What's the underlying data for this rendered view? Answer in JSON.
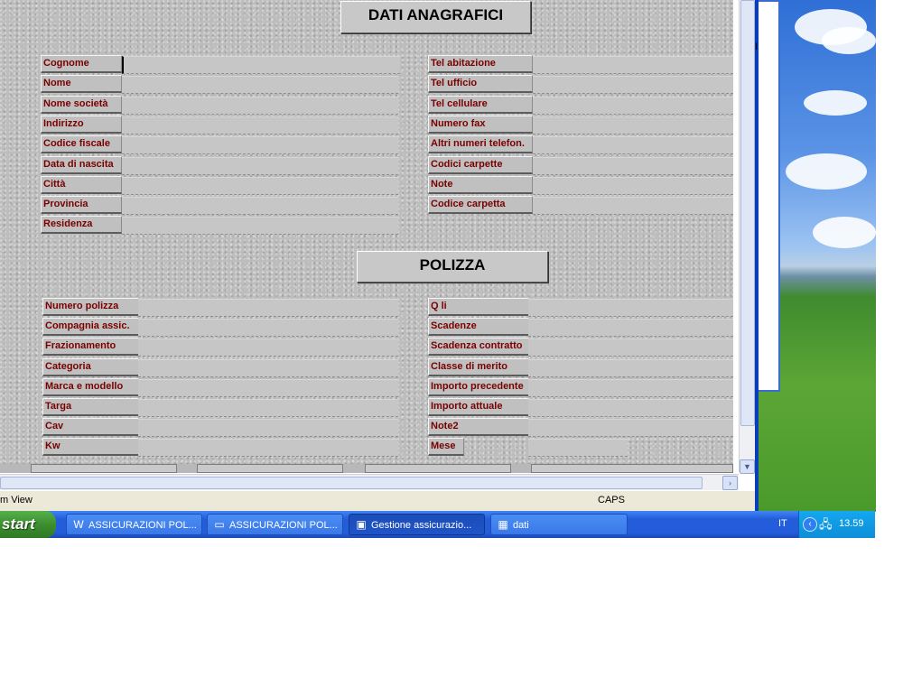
{
  "form": {
    "section1_title": "DATI ANAGRAFICI",
    "section2_title": "POLIZZA",
    "left1": [
      "Cognome",
      "Nome",
      "Nome società",
      "Indirizzo",
      "Codice fiscale",
      "Data di nascita",
      "Città",
      "Provincia",
      "Residenza"
    ],
    "right1": [
      "Tel  abitazione",
      "Tel ufficio",
      "Tel cellulare",
      "Numero fax",
      "Altri numeri telefon.",
      "Codici carpette",
      "Note",
      "Codice carpetta"
    ],
    "left2": [
      "Numero polizza",
      "Compagnia assic.",
      "Frazionamento",
      "Categoria",
      "Marca e modello",
      "Targa",
      "Cav",
      "Kw"
    ],
    "right2": [
      "Q li",
      "Scadenze",
      "Scadenza contratto",
      "Classe di merito",
      "Importo precedente",
      "Importo attuale",
      "Note2",
      "Mese"
    ]
  },
  "statusbar": {
    "left": "m View",
    "caps": "CAPS"
  },
  "desktop": {
    "partial_text": "I"
  },
  "taskbar": {
    "start": "start",
    "tasks": [
      {
        "label": "ASSICURAZIONI POL...",
        "icon": "word-doc-icon",
        "glyph": "W"
      },
      {
        "label": "ASSICURAZIONI POL...",
        "icon": "folder-icon",
        "glyph": "▭"
      },
      {
        "label": "Gestione assicurazio...",
        "icon": "access-form-icon",
        "glyph": "▣"
      },
      {
        "label": "dati",
        "icon": "table-icon",
        "glyph": "▦"
      }
    ],
    "lang": "IT",
    "clock": "13.59"
  }
}
